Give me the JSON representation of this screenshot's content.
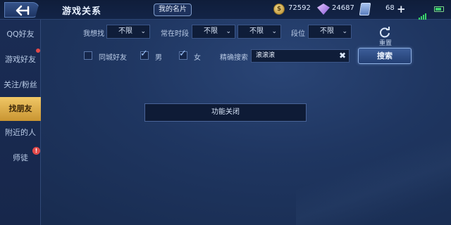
{
  "header": {
    "title": "游戏关系",
    "card_button": "我的名片",
    "coins": "72592",
    "coin_symbol": "$",
    "gems": "24687",
    "tickets": "68"
  },
  "sidebar": {
    "items": [
      {
        "label": "QQ好友",
        "active": false
      },
      {
        "label": "游戏好友",
        "active": false
      },
      {
        "label": "关注/粉丝",
        "active": false
      },
      {
        "label": "找朋友",
        "active": true
      },
      {
        "label": "附近的人",
        "active": false
      },
      {
        "label": "师徒",
        "active": false
      }
    ],
    "mentor_badge": "!"
  },
  "filters": {
    "want_find_label": "我想找",
    "want_find_value": "不限",
    "online_time_label": "常在时段",
    "online_time_value1": "不限",
    "online_time_value2": "不限",
    "rank_label": "段位",
    "rank_value": "不限",
    "reset_label": "重置",
    "same_city_label": "同城好友",
    "male_label": "男",
    "female_label": "女",
    "exact_search_label": "精确搜索",
    "search_value": "滚滚滚",
    "search_button": "搜索"
  },
  "notice": "功能关闭",
  "colors": {
    "accent_gold": "#e0b24c",
    "background": "#1b2d52",
    "badge_red": "#e24a4a"
  }
}
